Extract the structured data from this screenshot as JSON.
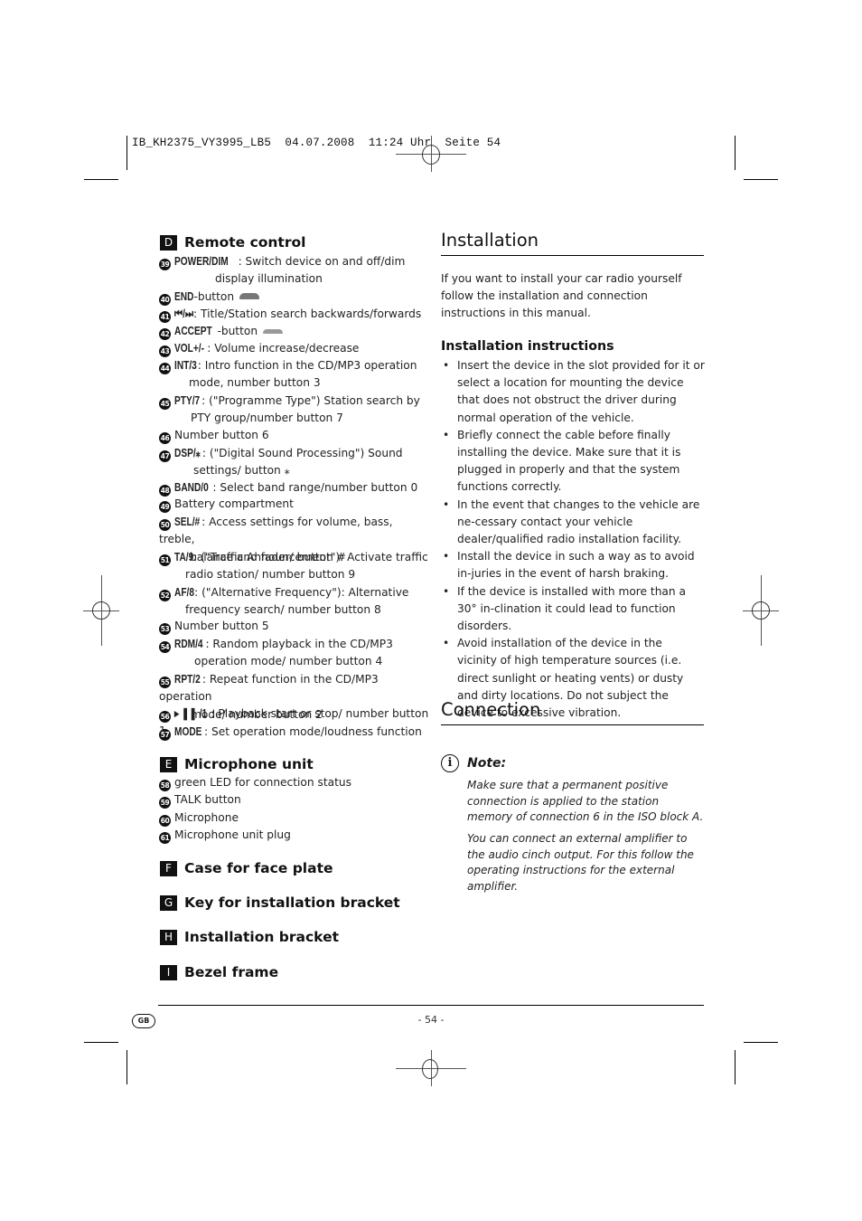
{
  "slug": "IB_KH2375_VY3995_LB5  04.07.2008  11:24 Uhr  Seite 54",
  "left": {
    "remote": {
      "letter": "D",
      "title": "Remote control",
      "items": [
        {
          "num": "39",
          "key": "POWER/DIM",
          "text": ": Switch device on and off/dim",
          "cont": "display illumination"
        },
        {
          "num": "40",
          "key": "END",
          "text": "-button",
          "icon": "end-call-icon"
        },
        {
          "num": "41",
          "key": "⏮/⏭",
          "text": ": Title/Station search backwards/forwards"
        },
        {
          "num": "42",
          "key": "ACCEPT",
          "text": "-button",
          "icon": "accept-call-icon"
        },
        {
          "num": "43",
          "key": "VOL+/-",
          "text": ": Volume increase/decrease"
        },
        {
          "num": "44",
          "key": "INT/3",
          "text": ": Intro function in the CD/MP3 operation",
          "cont": "mode, number button 3"
        },
        {
          "num": "45",
          "key": "PTY/7",
          "text": ": (\"Programme Type\") Station search by",
          "cont": "PTY group/number button 7"
        },
        {
          "num": "46",
          "key": "",
          "text": "Number button 6"
        },
        {
          "num": "47",
          "key": "DSP/⁎",
          "text": ": (\"Digital Sound Processing\") Sound",
          "cont": "settings/ button ⁎"
        },
        {
          "num": "48",
          "key": "BAND/0",
          "text": ": Select band range/number button 0"
        },
        {
          "num": "49",
          "key": "",
          "text": "Battery compartment"
        },
        {
          "num": "50",
          "key": "SEL/#",
          "text": ": Access settings for volume, bass, treble,",
          "cont": "balance and fader/ button #"
        },
        {
          "num": "51",
          "key": "TA/9",
          "text": ": (\"Traffic Announcement\"): Activate traffic",
          "cont": "radio station/ number button 9"
        },
        {
          "num": "52",
          "key": "AF/8",
          "text": ": (\"Alternative Frequency\"): Alternative",
          "cont": "frequency search/ number button 8"
        },
        {
          "num": "53",
          "key": "",
          "text": "Number button 5"
        },
        {
          "num": "54",
          "key": "RDM/4",
          "text": ": Random playback in the CD/MP3",
          "cont": "operation mode/ number button 4"
        },
        {
          "num": "55",
          "key": "RPT/2",
          "text": ": Repeat function in the CD/MP3 operation",
          "cont": "mode/ number button 2"
        },
        {
          "num": "56",
          "key": "▸ ❚❚ /1",
          "text": ": Playback start or stop/ number button 1"
        },
        {
          "num": "57",
          "key": "MODE",
          "text": ": Set operation mode/loudness function"
        }
      ]
    },
    "mic": {
      "letter": "E",
      "title": "Microphone unit",
      "items": [
        {
          "num": "58",
          "text": "green LED for connection status"
        },
        {
          "num": "59",
          "text": "TALK button"
        },
        {
          "num": "60",
          "text": "Microphone"
        },
        {
          "num": "61",
          "text": "Microphone unit plug"
        }
      ]
    },
    "others": [
      {
        "letter": "F",
        "title": "Case for face plate"
      },
      {
        "letter": "G",
        "title": "Key for installation bracket"
      },
      {
        "letter": "H",
        "title": "Installation bracket"
      },
      {
        "letter": "I",
        "title": "Bezel frame"
      }
    ]
  },
  "right": {
    "installation_title": "Installation",
    "intro": "If you want to install your car radio yourself follow the installation and connection instructions in this manual.",
    "instructions_title": "Installation instructions",
    "bullets": [
      "Insert the device in the slot provided for it or select a location for mounting the device that does not obstruct the driver during normal operation of the vehicle.",
      "Briefly connect the cable before finally installing the device. Make sure that it is plugged in properly and that the system functions correctly.",
      "In the event that changes to the vehicle are ne-cessary contact your vehicle dealer/qualified radio installation facility.",
      "Install the device in such a way as to avoid in-juries in the event of harsh braking.",
      "If the device is installed with more than a 30° in-clination it could lead to function disorders.",
      "Avoid installation of the device in the vicinity of high temperature sources (i.e. direct sunlight or heating vents) or dusty and dirty locations. Do not subject the device to excessive vibration."
    ],
    "connection_title": "Connection",
    "note_title": "Note:",
    "note_p1": "Make sure that a permanent positive connection is applied to the station memory of connection 6 in the ISO block A.",
    "note_p2": "You can connect an external amplifier to the audio cinch output. For this follow the operating instructions for the external amplifier."
  },
  "footer": {
    "lang": "GB",
    "page": "- 54 -"
  }
}
